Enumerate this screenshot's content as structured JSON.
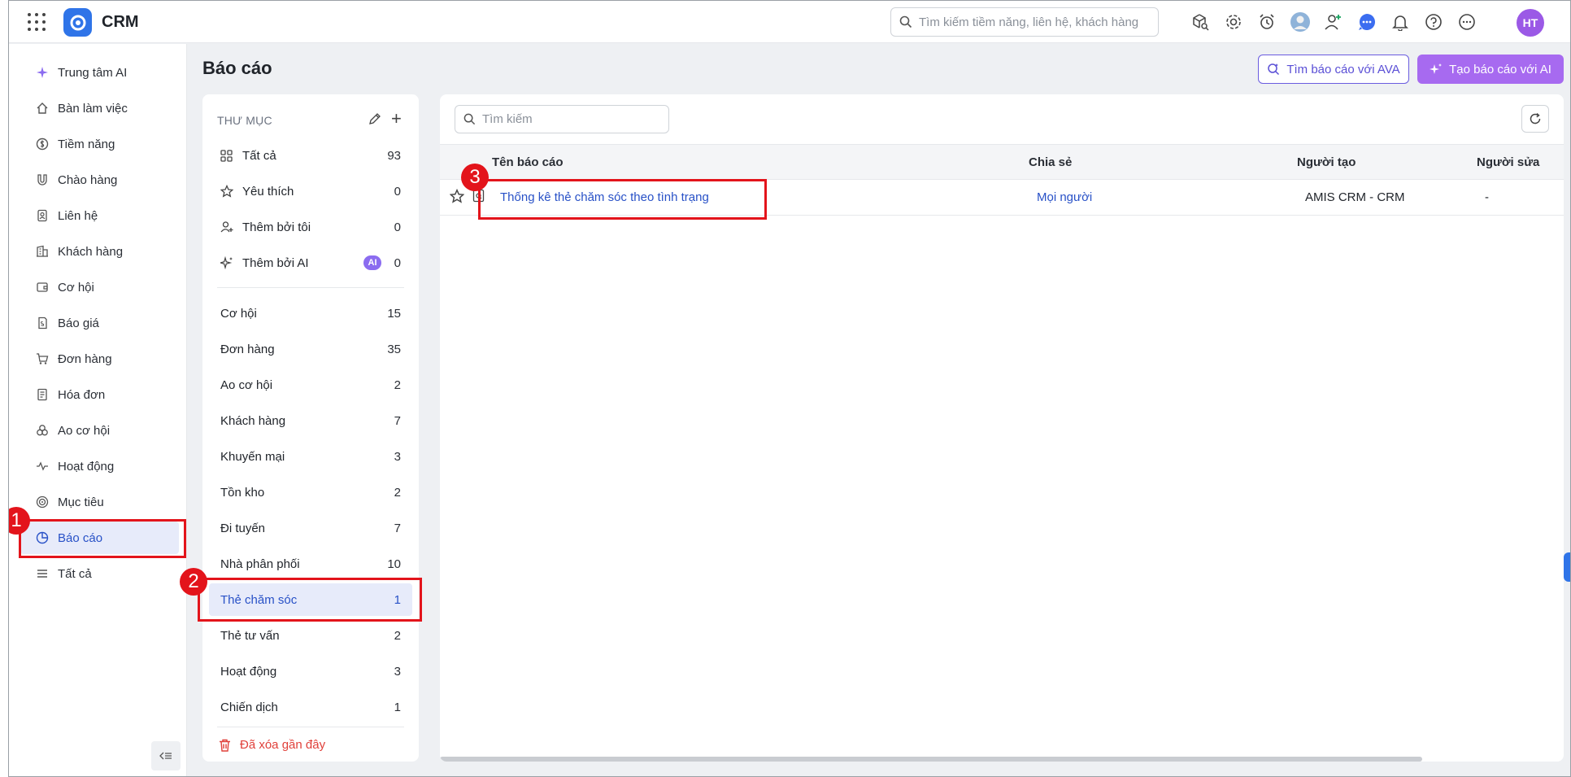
{
  "app": {
    "title": "CRM"
  },
  "topbar": {
    "search_placeholder": "Tìm kiếm tiềm năng, liên hệ, khách hàng",
    "avatar_initials": "HT"
  },
  "sidebar": {
    "items": [
      {
        "label": "Trung tâm AI",
        "icon": "sparkle-icon"
      },
      {
        "label": "Bàn làm việc",
        "icon": "home-icon"
      },
      {
        "label": "Tiềm năng",
        "icon": "dollar-icon"
      },
      {
        "label": "Chào hàng",
        "icon": "magnet-icon"
      },
      {
        "label": "Liên hệ",
        "icon": "contact-icon"
      },
      {
        "label": "Khách hàng",
        "icon": "building-icon"
      },
      {
        "label": "Cơ hội",
        "icon": "wallet-icon"
      },
      {
        "label": "Báo giá",
        "icon": "quote-icon"
      },
      {
        "label": "Đơn hàng",
        "icon": "cart-icon"
      },
      {
        "label": "Hóa đơn",
        "icon": "invoice-icon"
      },
      {
        "label": "Ao cơ hội",
        "icon": "pool-icon"
      },
      {
        "label": "Hoạt động",
        "icon": "activity-icon"
      },
      {
        "label": "Mục tiêu",
        "icon": "target-icon"
      },
      {
        "label": "Báo cáo",
        "icon": "pie-chart-icon",
        "active": true
      },
      {
        "label": "Tất cả",
        "icon": "menu-icon"
      }
    ]
  },
  "page": {
    "title": "Báo cáo",
    "ava_button": "Tìm báo cáo với AVA",
    "ai_button": "Tạo báo cáo với AI"
  },
  "folders": {
    "heading": "THƯ MỤC",
    "special": [
      {
        "label": "Tất cả",
        "count": "93",
        "icon": "grid-icon"
      },
      {
        "label": "Yêu thích",
        "count": "0",
        "icon": "star-icon"
      },
      {
        "label": "Thêm bởi tôi",
        "count": "0",
        "icon": "user-add-icon"
      },
      {
        "label": "Thêm bởi AI",
        "count": "0",
        "icon": "ai-sparkle-icon",
        "badge": "AI"
      }
    ],
    "items": [
      {
        "label": "Cơ hội",
        "count": "15"
      },
      {
        "label": "Đơn hàng",
        "count": "35"
      },
      {
        "label": "Ao cơ hội",
        "count": "2"
      },
      {
        "label": "Khách hàng",
        "count": "7"
      },
      {
        "label": "Khuyến mại",
        "count": "3"
      },
      {
        "label": "Tồn kho",
        "count": "2"
      },
      {
        "label": "Đi tuyến",
        "count": "7"
      },
      {
        "label": "Nhà phân phối",
        "count": "10"
      },
      {
        "label": "Thẻ chăm sóc",
        "count": "1",
        "active": true
      },
      {
        "label": "Thẻ tư vấn",
        "count": "2"
      },
      {
        "label": "Hoạt động",
        "count": "3"
      },
      {
        "label": "Chiến dịch",
        "count": "1"
      }
    ],
    "recently_deleted": "Đã xóa gần đây"
  },
  "reports": {
    "search_placeholder": "Tìm kiếm",
    "columns": [
      "Tên báo cáo",
      "Chia sẻ",
      "Người tạo",
      "Người sửa"
    ],
    "rows": [
      {
        "name": "Thống kê thẻ chăm sóc theo tình trạng",
        "share": "Mọi người",
        "creator": "AMIS CRM - CRM",
        "editor": "-"
      }
    ]
  },
  "annotations": [
    "1",
    "2",
    "3"
  ],
  "colors": {
    "accent": "#2851c7",
    "brand": "#2f74e8",
    "ai": "#a76af0",
    "highlight": "#e3141b"
  }
}
